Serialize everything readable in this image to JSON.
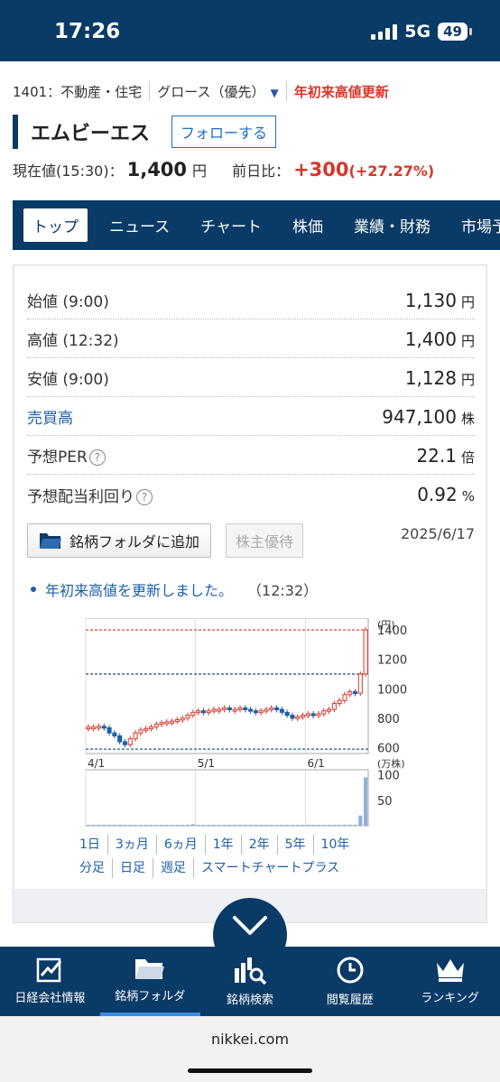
{
  "status": {
    "time": "17:26",
    "network": "5G",
    "battery": "49"
  },
  "breadcrumb": {
    "code_sector": "1401：不動産・住宅",
    "market": "グロース（優先）",
    "badge": "年初来高値更新"
  },
  "stock": {
    "name": "エムビーエス",
    "follow_label": "フォローする"
  },
  "price": {
    "label": "現在値(15:30)：",
    "value": "1,400",
    "unit": "円",
    "change_label": "前日比：",
    "change": "+300",
    "change_pct": "(+27.27%)"
  },
  "tabs": [
    "トップ",
    "ニュース",
    "チャート",
    "株価",
    "業績・財務",
    "市場予想"
  ],
  "quotes": [
    {
      "label": "始値 (9:00)",
      "value": "1,130",
      "unit": "円"
    },
    {
      "label": "高値 (12:32)",
      "value": "1,400",
      "unit": "円"
    },
    {
      "label": "安値 (9:00)",
      "value": "1,128",
      "unit": "円"
    },
    {
      "label": "売買高",
      "value": "947,100",
      "unit": "株"
    },
    {
      "label": "予想PER",
      "value": "22.1",
      "unit": "倍"
    },
    {
      "label": "予想配当利回り",
      "value": "0.92",
      "unit": "%"
    }
  ],
  "actions": {
    "folder_add": "銘柄フォルダに追加",
    "yutai": "株主優待",
    "date": "2025/6/17"
  },
  "news": {
    "text": "年初来高値を更新しました。",
    "time": "（12:32）"
  },
  "chart_data": {
    "type": "candlestick",
    "price_unit": "(円)",
    "volume_unit": "(万株)",
    "price_ticks": [
      "1400",
      "1200",
      "1000",
      "800",
      "600"
    ],
    "volume_ticks": [
      "100",
      "50"
    ],
    "x_labels": [
      "4/1",
      "5/1",
      "6/1"
    ],
    "ylim": [
      560,
      1480
    ],
    "reference_lines": [
      1400,
      1100,
      590
    ],
    "closes": [
      740,
      740,
      745,
      735,
      700,
      680,
      640,
      620,
      660,
      700,
      720,
      730,
      740,
      760,
      770,
      775,
      780,
      790,
      800,
      820,
      840,
      850,
      840,
      850,
      860,
      860,
      870,
      860,
      860,
      870,
      860,
      850,
      840,
      850,
      860,
      870,
      860,
      840,
      820,
      800,
      810,
      820,
      830,
      820,
      830,
      850,
      860,
      900,
      920,
      960,
      980,
      970,
      1100,
      1400
    ],
    "volumes": [
      1,
      1,
      1,
      1,
      1,
      1,
      2,
      1,
      1,
      1,
      1,
      1,
      1,
      1,
      1,
      1,
      1,
      1,
      1,
      2,
      3,
      1,
      1,
      1,
      1,
      1,
      1,
      1,
      1,
      1,
      1,
      1,
      1,
      1,
      1,
      1,
      1,
      1,
      1,
      1,
      1,
      1,
      1,
      1,
      1,
      1,
      1,
      1,
      1,
      2,
      2,
      2,
      20,
      95
    ]
  },
  "chart_ranges": [
    "1日",
    "3ヵ月",
    "6ヵ月",
    "1年",
    "2年",
    "5年",
    "10年"
  ],
  "chart_kinds": [
    "分足",
    "日足",
    "週足",
    "スマートチャートプラス"
  ],
  "bottom_nav": [
    "日経会社情報",
    "銘柄フォルダ",
    "銘柄検索",
    "閲覧履歴",
    "ランキング"
  ],
  "url": "nikkei.com",
  "colors": {
    "navy": "#0a3a66",
    "up_red": "#d6372a",
    "link_blue": "#1d5fa8"
  }
}
